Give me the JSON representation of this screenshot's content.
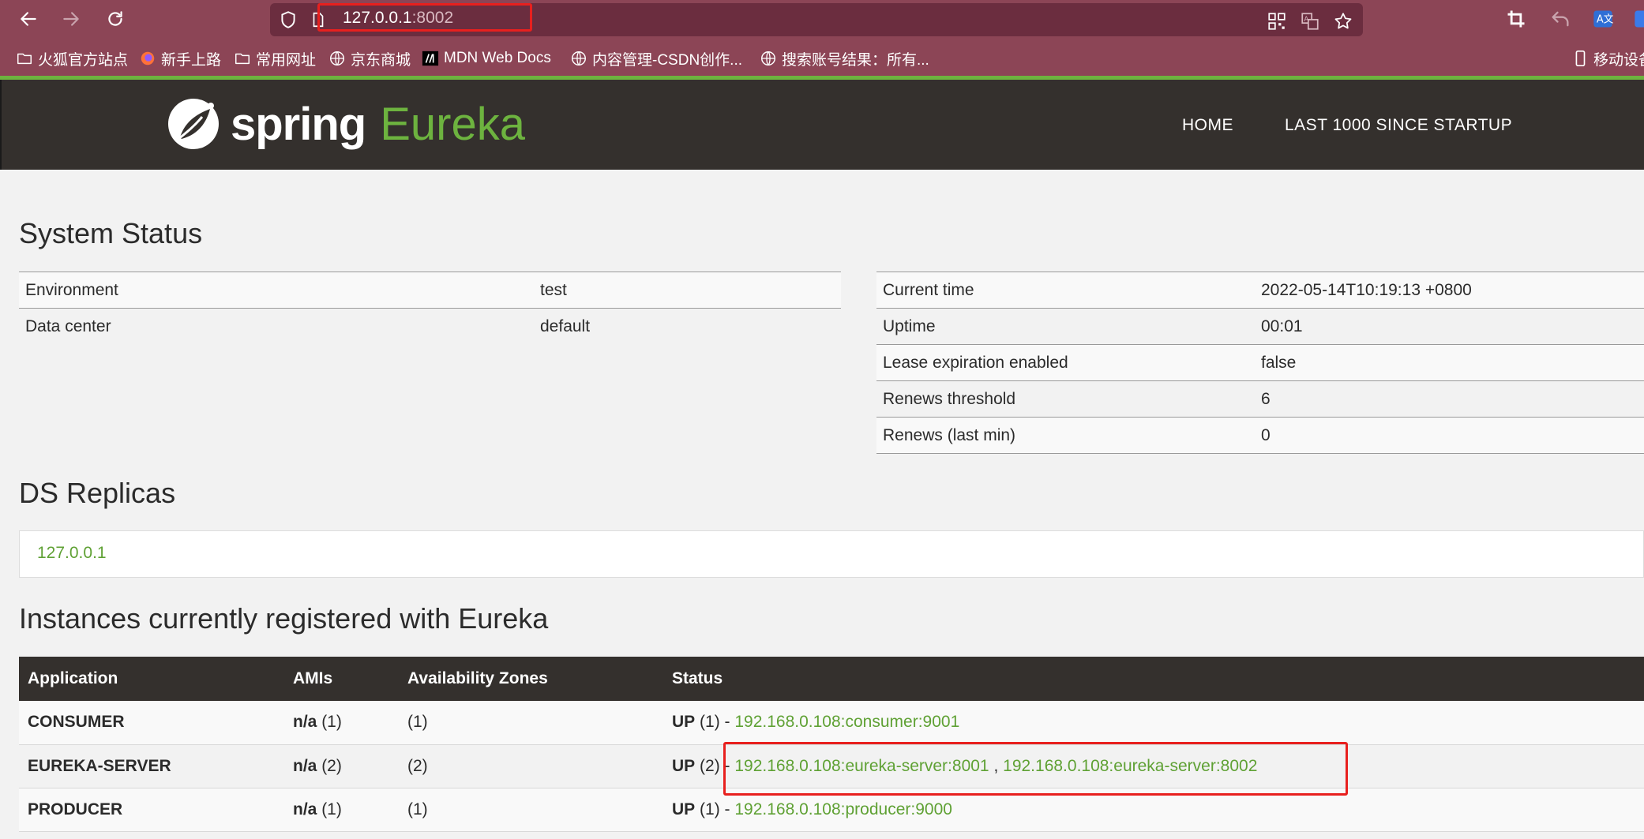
{
  "browser": {
    "url_host": "127.0.0.1",
    "url_port": ":8002",
    "bookmarks": [
      {
        "label": "火狐官方站点",
        "icon": "folder-icon"
      },
      {
        "label": "新手上路",
        "icon": "firefox-icon"
      },
      {
        "label": "常用网址",
        "icon": "folder-icon"
      },
      {
        "label": "京东商城",
        "icon": "globe-icon"
      },
      {
        "label": "MDN Web Docs",
        "icon": "mdn-icon"
      },
      {
        "label": "内容管理-CSDN创作...",
        "icon": "globe-icon"
      },
      {
        "label": "搜索账号结果：所有...",
        "icon": "globe-icon"
      }
    ],
    "mobile_bookmarks": "移动设备",
    "colors": {
      "chrome": "#8c4556",
      "urlbar": "#6b2d3f",
      "highlight": "#e8201e"
    }
  },
  "header": {
    "logo_spring": "spring",
    "logo_eureka": "Eureka",
    "nav": [
      "HOME",
      "LAST 1000 SINCE STARTUP"
    ],
    "colors": {
      "bg": "#34302d",
      "accent": "#6db33f"
    }
  },
  "system_status": {
    "title": "System Status",
    "left": [
      {
        "key": "Environment",
        "value": "test"
      },
      {
        "key": "Data center",
        "value": "default"
      }
    ],
    "right": [
      {
        "key": "Current time",
        "value": "2022-05-14T10:19:13 +0800"
      },
      {
        "key": "Uptime",
        "value": "00:01"
      },
      {
        "key": "Lease expiration enabled",
        "value": "false"
      },
      {
        "key": "Renews threshold",
        "value": "6"
      },
      {
        "key": "Renews (last min)",
        "value": "0"
      }
    ]
  },
  "ds_replicas": {
    "title": "DS Replicas",
    "items": [
      "127.0.0.1"
    ]
  },
  "instances": {
    "title": "Instances currently registered with Eureka",
    "columns": [
      "Application",
      "AMIs",
      "Availability Zones",
      "Status"
    ],
    "rows": [
      {
        "application": "CONSUMER",
        "amis_bold": "n/a",
        "amis_count": "(1)",
        "zones": "(1)",
        "status_state": "UP",
        "status_count": "(1) -",
        "links": [
          "192.168.0.108:consumer:9001"
        ]
      },
      {
        "application": "EUREKA-SERVER",
        "amis_bold": "n/a",
        "amis_count": "(2)",
        "zones": "(2)",
        "status_state": "UP",
        "status_count": "(2) -",
        "links": [
          "192.168.0.108:eureka-server:8001",
          "192.168.0.108:eureka-server:8002"
        ],
        "separator": ","
      },
      {
        "application": "PRODUCER",
        "amis_bold": "n/a",
        "amis_count": "(1)",
        "zones": "(1)",
        "status_state": "UP",
        "status_count": "(1) -",
        "links": [
          "192.168.0.108:producer:9000"
        ]
      }
    ]
  }
}
